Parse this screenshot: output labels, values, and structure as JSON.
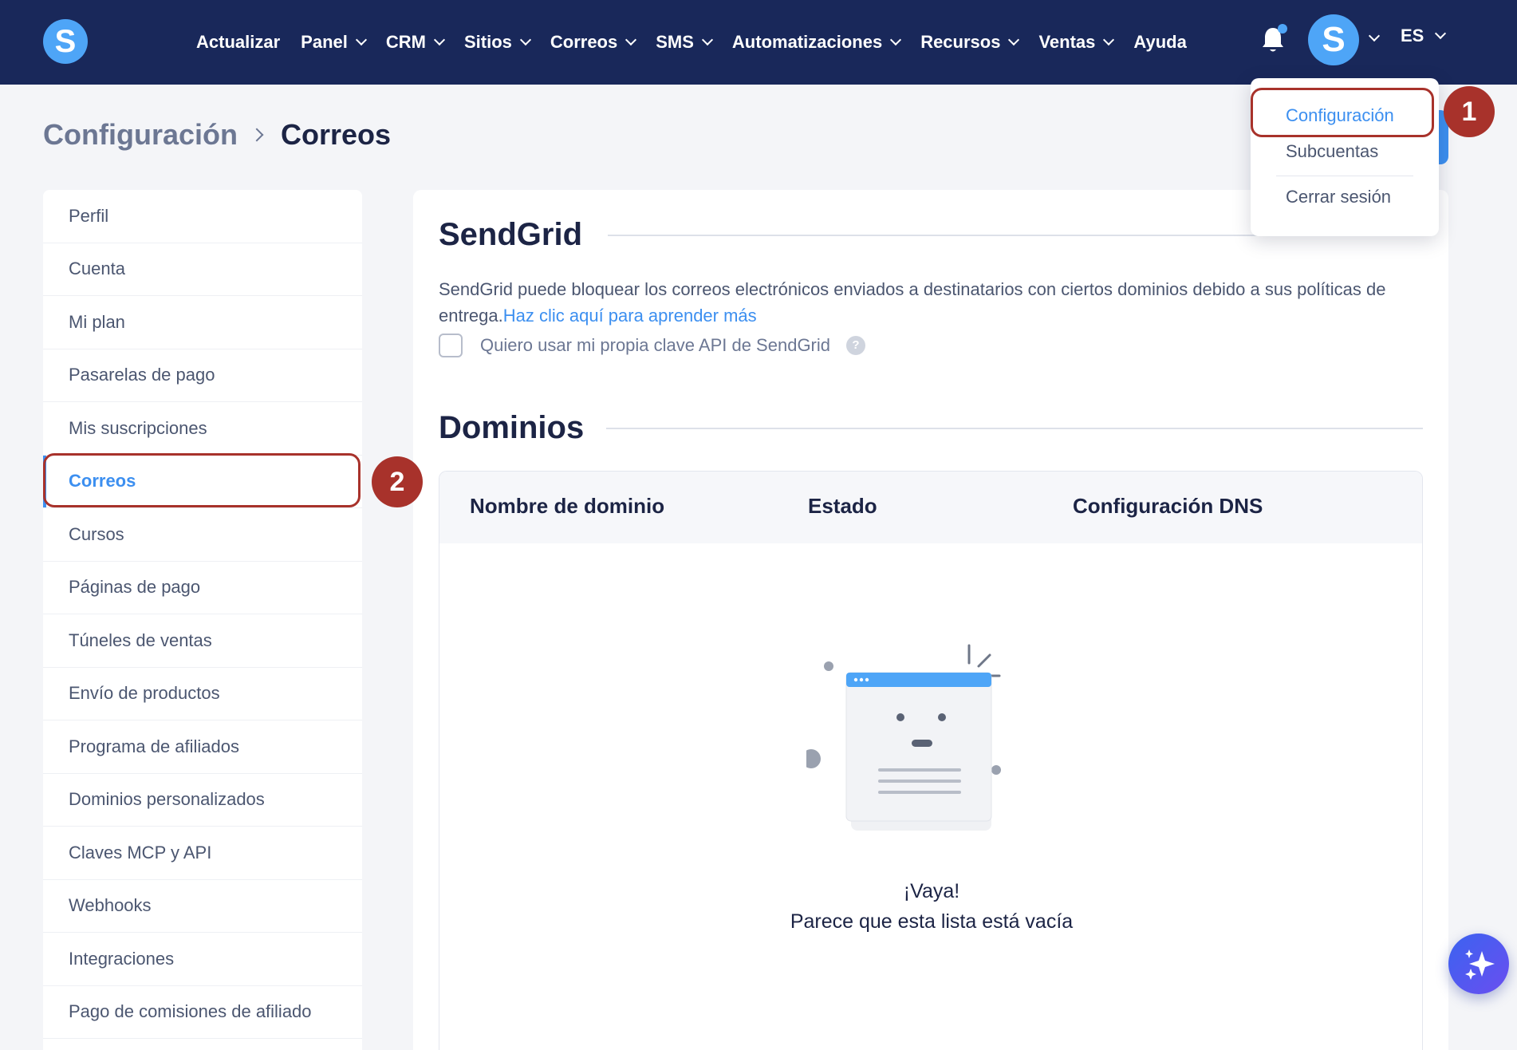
{
  "logo": {
    "letter": "S"
  },
  "nav": {
    "items": [
      {
        "label": "Actualizar",
        "dropdown": false
      },
      {
        "label": "Panel",
        "dropdown": true
      },
      {
        "label": "CRM",
        "dropdown": true
      },
      {
        "label": "Sitios",
        "dropdown": true
      },
      {
        "label": "Correos",
        "dropdown": true
      },
      {
        "label": "SMS",
        "dropdown": true
      },
      {
        "label": "Automatizaciones",
        "dropdown": true
      },
      {
        "label": "Recursos",
        "dropdown": true
      },
      {
        "label": "Ventas",
        "dropdown": true
      },
      {
        "label": "Ayuda",
        "dropdown": false
      }
    ],
    "avatar_letter": "S",
    "language": "ES"
  },
  "breadcrumb": {
    "parent": "Configuración",
    "current": "Correos"
  },
  "sidebar": {
    "items": [
      {
        "label": "Perfil",
        "active": false
      },
      {
        "label": "Cuenta",
        "active": false
      },
      {
        "label": "Mi plan",
        "active": false
      },
      {
        "label": "Pasarelas de pago",
        "active": false
      },
      {
        "label": "Mis suscripciones",
        "active": false
      },
      {
        "label": "Correos",
        "active": true
      },
      {
        "label": "Cursos",
        "active": false
      },
      {
        "label": "Páginas de pago",
        "active": false
      },
      {
        "label": "Túneles de ventas",
        "active": false
      },
      {
        "label": "Envío de productos",
        "active": false
      },
      {
        "label": "Programa de afiliados",
        "active": false
      },
      {
        "label": "Dominios personalizados",
        "active": false
      },
      {
        "label": "Claves MCP y API",
        "active": false
      },
      {
        "label": "Webhooks",
        "active": false
      },
      {
        "label": "Integraciones",
        "active": false
      },
      {
        "label": "Pago de comisiones de afiliado",
        "active": false
      }
    ]
  },
  "sendgrid": {
    "title": "SendGrid",
    "description": "SendGrid puede bloquear los correos electrónicos enviados a destinatarios con ciertos dominios debido a sus políticas de entrega.",
    "link_text": "Haz clic aquí para aprender más",
    "checkbox_label": "Quiero usar mi propia clave API de SendGrid",
    "help_glyph": "?"
  },
  "domains": {
    "title": "Dominios",
    "columns": [
      "Nombre de dominio",
      "Estado",
      "Configuración DNS"
    ],
    "empty_title": "¡Vaya!",
    "empty_subtitle": "Parece que esta lista está vacía"
  },
  "user_menu": {
    "items": [
      "Configuración",
      "Subcuentas",
      "Cerrar sesión"
    ]
  },
  "annotations": [
    "1",
    "2"
  ],
  "colors": {
    "nav_bg": "#19285a",
    "accent": "#3c8ff0",
    "annotation": "#a8322b"
  }
}
